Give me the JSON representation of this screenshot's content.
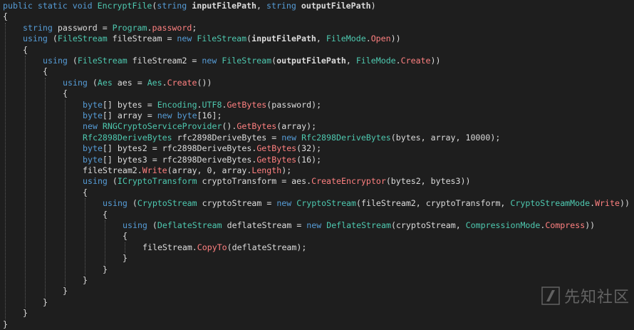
{
  "colors": {
    "background": "#1e1e1e",
    "plain": "#dcdcdc",
    "keyword": "#569cd6",
    "type": "#4ec9b0",
    "method": "#ff8080",
    "indent_guide": "#5a5a5a"
  },
  "watermark": {
    "text": "先知社区",
    "icon": "xianzhi-logo-icon"
  },
  "code": {
    "lines": [
      {
        "indent": 0,
        "tokens": [
          [
            "kw",
            "public static void "
          ],
          [
            "type",
            "EncryptFile"
          ],
          [
            "p",
            "("
          ],
          [
            "kw",
            "string "
          ],
          [
            "b",
            "inputFilePath"
          ],
          [
            "p",
            ", "
          ],
          [
            "kw",
            "string "
          ],
          [
            "b",
            "outputFilePath"
          ],
          [
            "p",
            ")"
          ]
        ]
      },
      {
        "indent": 0,
        "tokens": [
          [
            "p",
            "{"
          ]
        ]
      },
      {
        "indent": 1,
        "tokens": [
          [
            "kw",
            "string "
          ],
          [
            "p",
            "password = "
          ],
          [
            "type",
            "Program"
          ],
          [
            "p",
            "."
          ],
          [
            "method",
            "password"
          ],
          [
            "p",
            ";"
          ]
        ]
      },
      {
        "indent": 1,
        "tokens": [
          [
            "kw",
            "using "
          ],
          [
            "p",
            "("
          ],
          [
            "type",
            "FileStream"
          ],
          [
            "p",
            " fileStream = "
          ],
          [
            "kw",
            "new "
          ],
          [
            "type",
            "FileStream"
          ],
          [
            "p",
            "("
          ],
          [
            "b",
            "inputFilePath"
          ],
          [
            "p",
            ", "
          ],
          [
            "type",
            "FileMode"
          ],
          [
            "p",
            "."
          ],
          [
            "method",
            "Open"
          ],
          [
            "p",
            "))"
          ]
        ]
      },
      {
        "indent": 1,
        "tokens": [
          [
            "p",
            "{"
          ]
        ]
      },
      {
        "indent": 2,
        "tokens": [
          [
            "kw",
            "using "
          ],
          [
            "p",
            "("
          ],
          [
            "type",
            "FileStream"
          ],
          [
            "p",
            " fileStream2 = "
          ],
          [
            "kw",
            "new "
          ],
          [
            "type",
            "FileStream"
          ],
          [
            "p",
            "("
          ],
          [
            "b",
            "outputFilePath"
          ],
          [
            "p",
            ", "
          ],
          [
            "type",
            "FileMode"
          ],
          [
            "p",
            "."
          ],
          [
            "method",
            "Create"
          ],
          [
            "p",
            "))"
          ]
        ]
      },
      {
        "indent": 2,
        "tokens": [
          [
            "p",
            "{"
          ]
        ]
      },
      {
        "indent": 3,
        "tokens": [
          [
            "kw",
            "using "
          ],
          [
            "p",
            "("
          ],
          [
            "type",
            "Aes"
          ],
          [
            "p",
            " aes = "
          ],
          [
            "type",
            "Aes"
          ],
          [
            "p",
            "."
          ],
          [
            "method",
            "Create"
          ],
          [
            "p",
            "())"
          ]
        ]
      },
      {
        "indent": 3,
        "tokens": [
          [
            "p",
            "{"
          ]
        ]
      },
      {
        "indent": 4,
        "tokens": [
          [
            "kw",
            "byte"
          ],
          [
            "p",
            "[] bytes = "
          ],
          [
            "type",
            "Encoding"
          ],
          [
            "p",
            "."
          ],
          [
            "type",
            "UTF8"
          ],
          [
            "p",
            "."
          ],
          [
            "method",
            "GetBytes"
          ],
          [
            "p",
            "(password);"
          ]
        ]
      },
      {
        "indent": 4,
        "tokens": [
          [
            "kw",
            "byte"
          ],
          [
            "p",
            "[] array = "
          ],
          [
            "kw",
            "new byte"
          ],
          [
            "p",
            "[16];"
          ]
        ]
      },
      {
        "indent": 4,
        "tokens": [
          [
            "kw",
            "new "
          ],
          [
            "type",
            "RNGCryptoServiceProvider"
          ],
          [
            "p",
            "()."
          ],
          [
            "method",
            "GetBytes"
          ],
          [
            "p",
            "(array);"
          ]
        ]
      },
      {
        "indent": 4,
        "tokens": [
          [
            "type",
            "Rfc2898DeriveBytes"
          ],
          [
            "p",
            " rfc2898DeriveBytes = "
          ],
          [
            "kw",
            "new "
          ],
          [
            "type",
            "Rfc2898DeriveBytes"
          ],
          [
            "p",
            "(bytes, array, 10000);"
          ]
        ]
      },
      {
        "indent": 4,
        "tokens": [
          [
            "kw",
            "byte"
          ],
          [
            "p",
            "[] bytes2 = rfc2898DeriveBytes."
          ],
          [
            "method",
            "GetBytes"
          ],
          [
            "p",
            "(32);"
          ]
        ]
      },
      {
        "indent": 4,
        "tokens": [
          [
            "kw",
            "byte"
          ],
          [
            "p",
            "[] bytes3 = rfc2898DeriveBytes."
          ],
          [
            "method",
            "GetBytes"
          ],
          [
            "p",
            "(16);"
          ]
        ]
      },
      {
        "indent": 4,
        "tokens": [
          [
            "p",
            "fileStream2."
          ],
          [
            "method",
            "Write"
          ],
          [
            "p",
            "(array, 0, array."
          ],
          [
            "method",
            "Length"
          ],
          [
            "p",
            ");"
          ]
        ]
      },
      {
        "indent": 4,
        "tokens": [
          [
            "kw",
            "using "
          ],
          [
            "p",
            "("
          ],
          [
            "type",
            "ICryptoTransform"
          ],
          [
            "p",
            " cryptoTransform = aes."
          ],
          [
            "method",
            "CreateEncryptor"
          ],
          [
            "p",
            "(bytes2, bytes3))"
          ]
        ]
      },
      {
        "indent": 4,
        "tokens": [
          [
            "p",
            "{"
          ]
        ]
      },
      {
        "indent": 5,
        "tokens": [
          [
            "kw",
            "using "
          ],
          [
            "p",
            "("
          ],
          [
            "type",
            "CryptoStream"
          ],
          [
            "p",
            " cryptoStream = "
          ],
          [
            "kw",
            "new "
          ],
          [
            "type",
            "CryptoStream"
          ],
          [
            "p",
            "(fileStream2, cryptoTransform, "
          ],
          [
            "type",
            "CryptoStreamMode"
          ],
          [
            "p",
            "."
          ],
          [
            "method",
            "Write"
          ],
          [
            "p",
            "))"
          ]
        ]
      },
      {
        "indent": 5,
        "tokens": [
          [
            "p",
            "{"
          ]
        ]
      },
      {
        "indent": 6,
        "tokens": [
          [
            "kw",
            "using "
          ],
          [
            "p",
            "("
          ],
          [
            "type",
            "DeflateStream"
          ],
          [
            "p",
            " deflateStream = "
          ],
          [
            "kw",
            "new "
          ],
          [
            "type",
            "DeflateStream"
          ],
          [
            "p",
            "(cryptoStream, "
          ],
          [
            "type",
            "CompressionMode"
          ],
          [
            "p",
            "."
          ],
          [
            "method",
            "Compress"
          ],
          [
            "p",
            "))"
          ]
        ]
      },
      {
        "indent": 6,
        "tokens": [
          [
            "p",
            "{"
          ]
        ]
      },
      {
        "indent": 7,
        "tokens": [
          [
            "p",
            "fileStream."
          ],
          [
            "method",
            "CopyTo"
          ],
          [
            "p",
            "(deflateStream);"
          ]
        ]
      },
      {
        "indent": 6,
        "tokens": [
          [
            "p",
            "}"
          ]
        ]
      },
      {
        "indent": 5,
        "tokens": [
          [
            "p",
            "}"
          ]
        ]
      },
      {
        "indent": 4,
        "tokens": [
          [
            "p",
            "}"
          ]
        ]
      },
      {
        "indent": 3,
        "tokens": [
          [
            "p",
            "}"
          ]
        ]
      },
      {
        "indent": 2,
        "tokens": [
          [
            "p",
            "}"
          ]
        ]
      },
      {
        "indent": 1,
        "tokens": [
          [
            "p",
            "}"
          ]
        ]
      },
      {
        "indent": 0,
        "tokens": [
          [
            "p",
            "}"
          ]
        ]
      }
    ]
  }
}
